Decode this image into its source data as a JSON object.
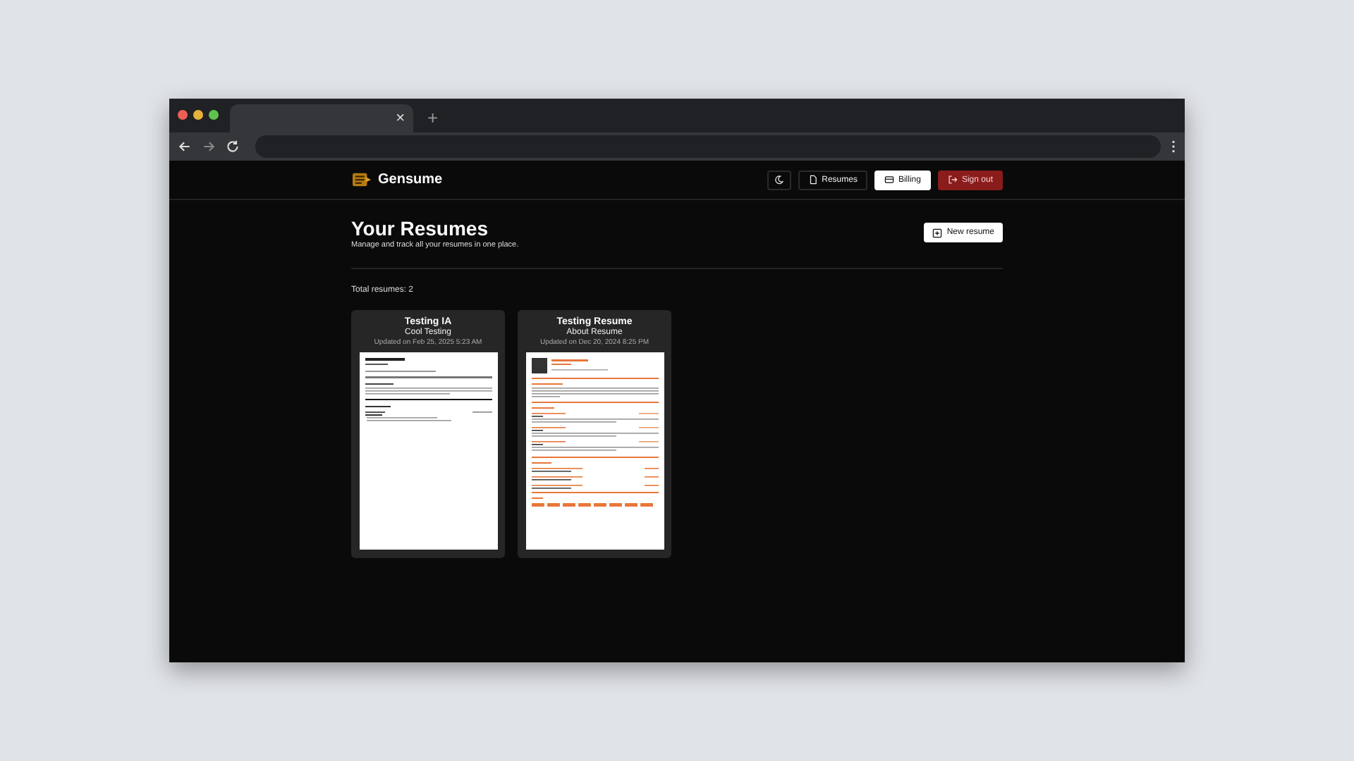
{
  "browser": {
    "tab": {
      "close": "×"
    },
    "new_tab": "+"
  },
  "header": {
    "brand": "Gensume",
    "nav": [
      {
        "kind": "icon"
      },
      {
        "kind": "outline",
        "label": "Resumes"
      },
      {
        "kind": "light",
        "label": "Billing"
      },
      {
        "kind": "danger",
        "label": "Sign out"
      }
    ]
  },
  "page": {
    "title": "Your Resumes",
    "subtitle": "Manage and track all your resumes in one place.",
    "new_button": "New resume",
    "total": "Total resumes: 2"
  },
  "resumes": [
    {
      "title": "Testing IA",
      "subtitle": "Cool Testing",
      "updated": "Updated on Feb 25, 2025 5:23 AM",
      "kind": "plain"
    },
    {
      "title": "Testing Resume",
      "subtitle": "About Resume",
      "updated": "Updated on Dec 20, 2024 8:25 PM",
      "kind": "orange"
    }
  ]
}
